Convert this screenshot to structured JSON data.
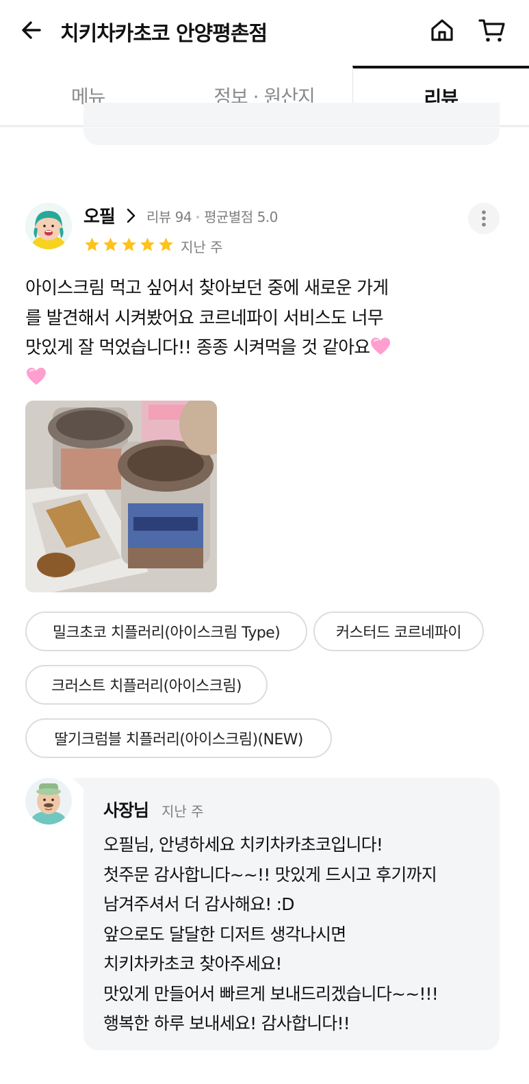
{
  "header": {
    "store_title": "치키차카초코 안양평촌점",
    "back_icon": "arrow-left-icon",
    "home_icon": "home-icon",
    "cart_icon": "cart-icon"
  },
  "tabs": [
    {
      "label": "메뉴",
      "active": false
    },
    {
      "label": "정보 · 원산지",
      "active": false
    },
    {
      "label": "리뷰",
      "active": true
    }
  ],
  "review": {
    "reviewer_name": "오필",
    "review_count": "리뷰 94",
    "avg_rating": "평균별점 5.0",
    "rating": 5,
    "date": "지난 주",
    "text_lines": [
      "아이스크림 먹고 싶어서 찾아보던 중에 새로운 가게",
      "를 발견해서 시켜봤어요 코르네파이 서비스도 너무",
      "맛있게 잘 먹었습니다!! 종종 시켜먹을 것 같아요"
    ],
    "emoji": "pink-heart-icon",
    "menu_tags": [
      "밀크초코 치플러리(아이스크림 Type)",
      "커스터드 코르네파이",
      "크러스트 치플러리(아이스크림)",
      "딸기크럼블 치플러리(아이스크림)(NEW)"
    ],
    "star_color": "#FFC21C"
  },
  "reply": {
    "owner_name": "사장님",
    "date": "지난 주",
    "text": "오필님, 안녕하세요 치키차카초코입니다!\n첫주문 감사합니다~~!! 맛있게 드시고 후기까지\n남겨주셔서 더 감사해요! :D\n앞으로도 달달한 디저트 생각나시면\n치키차카초코 찾아주세요!\n맛있게 만들어서 빠르게 보내드리겠습니다~~!!!\n행복한 하루 보내세요! 감사합니다!!"
  }
}
